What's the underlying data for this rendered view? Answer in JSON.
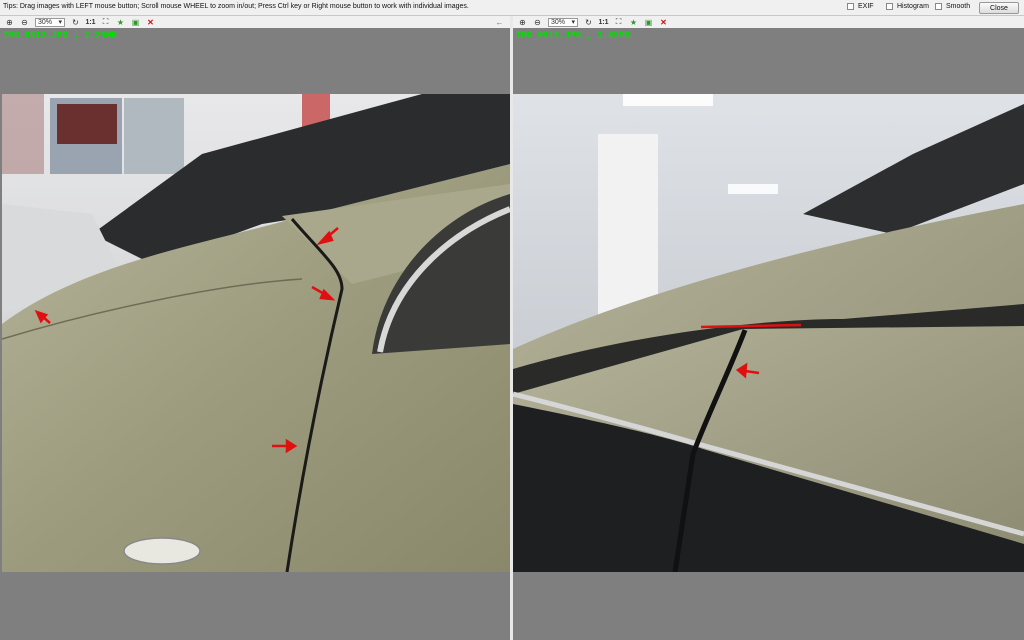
{
  "topbar": {
    "tips": "Tips: Drag images with LEFT mouse button; Scroll mouse WHEEL to zoom in/out; Press Ctrl key or Right mouse button to work with individual images.",
    "options": [
      {
        "label": "EXIF",
        "checked": false
      },
      {
        "label": "Histogram",
        "checked": false
      },
      {
        "label": "Smooth",
        "checked": false
      }
    ],
    "close_label": "Close"
  },
  "left_pane": {
    "zoom_value": "30%",
    "ratio_label": "1:1",
    "caption": "IMG_0512.JPG , 2.25MB"
  },
  "right_pane": {
    "zoom_value": "30%",
    "ratio_label": "1:1",
    "caption": "IMG_0515.JPG , 1.85MB"
  },
  "icons": [
    "zoom-in-icon",
    "zoom-out-icon",
    "refresh-icon",
    "fit-screen-icon",
    "star-icon",
    "export-icon",
    "close-icon",
    "arrow-left-icon"
  ],
  "colors": {
    "caption": "#00e000",
    "annotation": "#e01010",
    "car_paint": "#9a9878"
  }
}
